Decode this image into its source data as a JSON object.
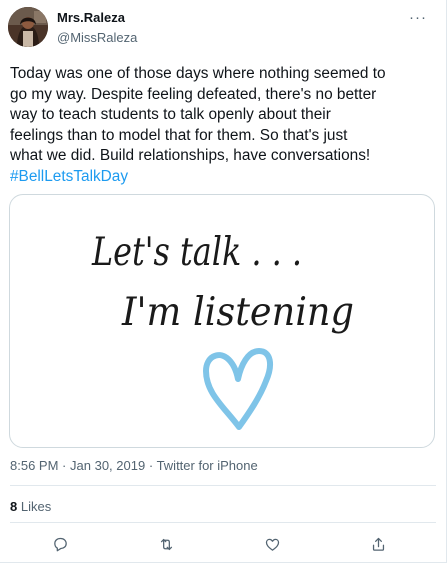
{
  "tweet": {
    "user": {
      "display_name": "Mrs.Raleza",
      "handle": "@MissRaleza",
      "avatar_icon": "profile-photo"
    },
    "more_icon": "ellipsis-icon",
    "more_label": "···",
    "text_lines": [
      "Today was one of those days where nothing seemed to",
      "go my way. Despite feeling defeated, there's no better",
      "way to teach students to talk openly about their",
      "feelings than to model that for them. So that's just",
      "what we did. Build relationships, have conversations!"
    ],
    "hashtag": "#BellLetsTalkDay",
    "media": {
      "handwriting_line1": "Let's talk . . .",
      "handwriting_line2": "I'm listening",
      "heart_color": "#7fc4e8"
    },
    "time": "8:56 PM",
    "date": "Jan 30, 2019",
    "separator": "·",
    "source": "Twitter for iPhone",
    "likes_count": "8",
    "likes_label": "Likes",
    "actions": [
      {
        "name": "reply",
        "icon": "reply-icon"
      },
      {
        "name": "retweet",
        "icon": "retweet-icon"
      },
      {
        "name": "like",
        "icon": "heart-icon"
      },
      {
        "name": "share",
        "icon": "share-icon"
      }
    ]
  },
  "colors": {
    "text": "#0f1419",
    "secondary": "#536471",
    "link": "#1d9bf0",
    "border": "#cfd9de"
  }
}
